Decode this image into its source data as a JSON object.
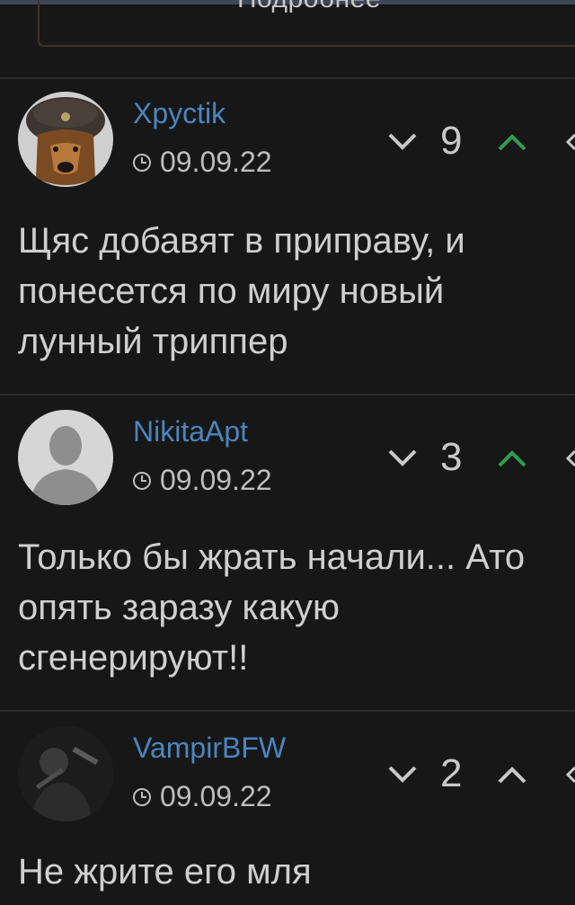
{
  "header": {
    "more_label": "Подробнее"
  },
  "comments": [
    {
      "username": "Xpyctik",
      "date": "09.09.22",
      "rating": "9",
      "upvote_color": "#2e9e4e",
      "text": "Щяс добавят в приправу, и понесется по миру новый лунный триппер"
    },
    {
      "username": "NikitaApt",
      "date": "09.09.22",
      "rating": "3",
      "upvote_color": "#2e9e4e",
      "text": "Только бы жрать начали... Ато опять заразу какую сгенерируют!!"
    },
    {
      "username": "VampirBFW",
      "date": "09.09.22",
      "rating": "2",
      "upvote_color": "#c9c9c9",
      "text": "Не жрите его мля"
    }
  ],
  "icons": {
    "clock": "clock-icon",
    "downvote": "chevron-down-icon",
    "upvote": "chevron-up-icon",
    "more": "chevron-left-icon"
  },
  "colors": {
    "background": "#171717",
    "username": "#4a86c0",
    "divider": "#2c2c2c"
  }
}
